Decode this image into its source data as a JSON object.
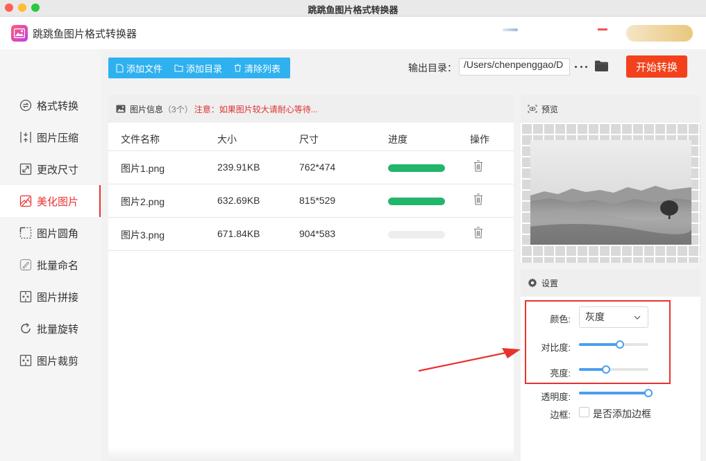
{
  "window": {
    "title": "跳跳鱼图片格式转换器"
  },
  "app": {
    "name": "跳跳鱼图片格式转换器"
  },
  "sidebar": {
    "items": [
      {
        "label": "格式转换",
        "icon": "convert-icon",
        "active": false
      },
      {
        "label": "图片压缩",
        "icon": "compress-icon",
        "active": false
      },
      {
        "label": "更改尺寸",
        "icon": "resize-icon",
        "active": false
      },
      {
        "label": "美化图片",
        "icon": "beautify-icon",
        "active": true
      },
      {
        "label": "图片圆角",
        "icon": "round-corner-icon",
        "active": false
      },
      {
        "label": "批量命名",
        "icon": "rename-icon",
        "active": false
      },
      {
        "label": "图片拼接",
        "icon": "stitch-icon",
        "active": false
      },
      {
        "label": "批量旋转",
        "icon": "rotate-icon",
        "active": false
      },
      {
        "label": "图片裁剪",
        "icon": "crop-icon",
        "active": false
      }
    ]
  },
  "toolbar": {
    "add_file": "添加文件",
    "add_dir": "添加目录",
    "clear_list": "清除列表",
    "output_label": "输出目录：",
    "output_path": "/Users/chenpenggao/D",
    "start": "开始转换"
  },
  "file_panel": {
    "title": "图片信息",
    "count": "（3个）",
    "warning": "注意：如果图片较大请耐心等待...",
    "columns": {
      "name": "文件名称",
      "size": "大小",
      "dims": "尺寸",
      "progress": "进度",
      "action": "操作"
    },
    "rows": [
      {
        "name": "图片1.png",
        "size": "239.91KB",
        "dims": "762*474",
        "progress": 1.0
      },
      {
        "name": "图片2.png",
        "size": "632.69KB",
        "dims": "815*529",
        "progress": 1.0
      },
      {
        "name": "图片3.png",
        "size": "671.84KB",
        "dims": "904*583",
        "progress": 0.0
      }
    ]
  },
  "preview": {
    "title": "预览"
  },
  "settings": {
    "title": "设置",
    "color_label": "颜色:",
    "color_value": "灰度",
    "contrast_label": "对比度:",
    "contrast": 0.59,
    "brightness_label": "亮度:",
    "brightness": 0.39,
    "opacity_label": "透明度:",
    "opacity": 1.0,
    "border_label": "边框:",
    "border_checkbox": "是否添加边框",
    "border_checked": false
  },
  "colors": {
    "accent_red": "#e8322e",
    "toolbar_blue": "#2fb1f0",
    "start_orange": "#f2411b",
    "progress_green": "#21b66c",
    "slider_blue": "#4a9ff0"
  }
}
